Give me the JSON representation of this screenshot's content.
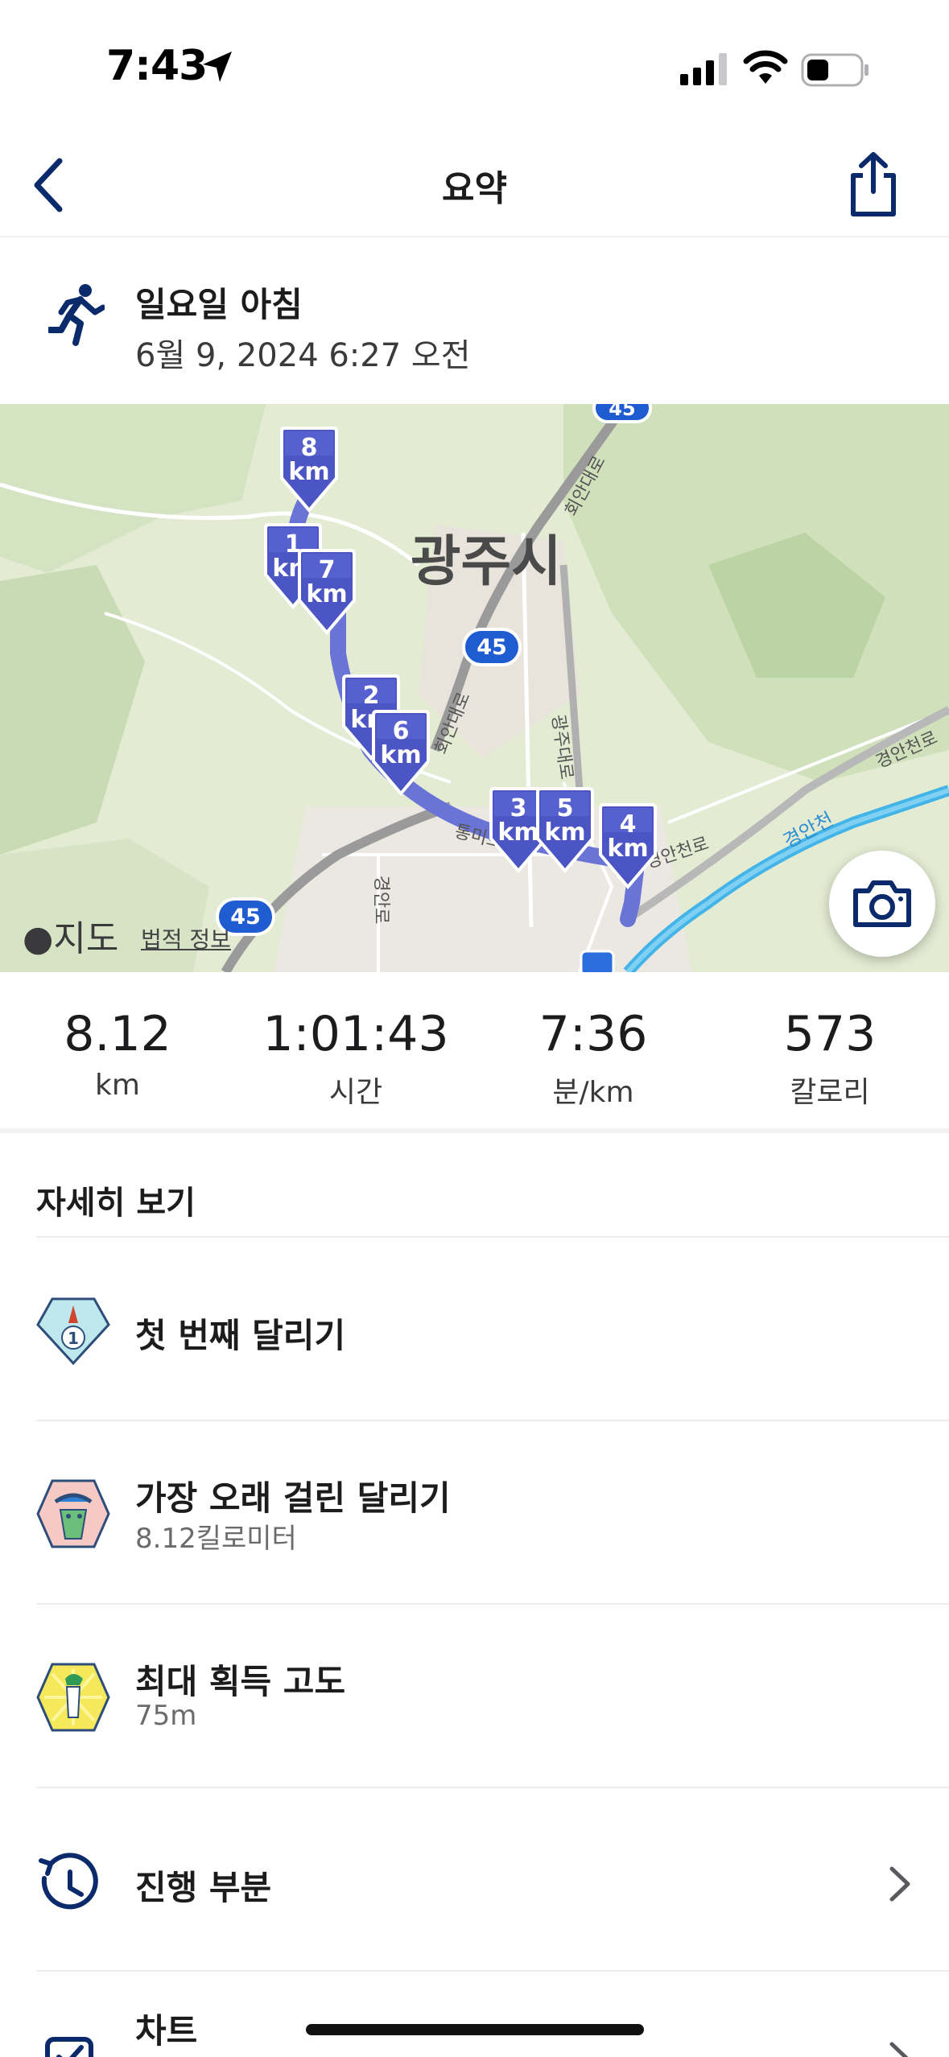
{
  "status_bar": {
    "time": "7:43"
  },
  "nav": {
    "title": "요약",
    "back_icon": "chevron-left-icon",
    "share_icon": "share-icon"
  },
  "activity": {
    "name": "일요일 아침",
    "datetime": "6월 9, 2024 6:27 오전",
    "icon": "runner-icon"
  },
  "map": {
    "city_label": "광주시",
    "attribution": "지도",
    "legal": "법적 정보",
    "route_shields": [
      "45",
      "45",
      "45",
      "45"
    ],
    "road_labels": [
      "회안대로",
      "회안대로",
      "광주대로",
      "통미로",
      "경안천로",
      "경안천로",
      "경안천",
      "경안로"
    ],
    "km_markers": [
      {
        "num": "8",
        "unit": "km"
      },
      {
        "num": "1",
        "unit": "km"
      },
      {
        "num": "7",
        "unit": "km"
      },
      {
        "num": "2",
        "unit": "km"
      },
      {
        "num": "6",
        "unit": "km"
      },
      {
        "num": "3",
        "unit": "km"
      },
      {
        "num": "5",
        "unit": "km"
      },
      {
        "num": "4",
        "unit": "km"
      }
    ]
  },
  "stats": [
    {
      "value": "8.12",
      "unit": "km"
    },
    {
      "value": "1:01:43",
      "unit": "시간"
    },
    {
      "value": "7:36",
      "unit": "분/km"
    },
    {
      "value": "573",
      "unit": "칼로리"
    }
  ],
  "details": {
    "title": "자세히 보기",
    "items": [
      {
        "title": "첫 번째 달리기",
        "subtitle": "",
        "icon": "first-run-badge-icon"
      },
      {
        "title": "가장 오래 걸린 달리기",
        "subtitle": "8.12킬로미터",
        "icon": "longest-run-badge-icon"
      },
      {
        "title": "최대 획득 고도",
        "subtitle": "75m",
        "icon": "elevation-badge-icon"
      },
      {
        "title": "진행 부분",
        "subtitle": "",
        "icon": "clock-icon"
      },
      {
        "title": "차트",
        "subtitle": "",
        "icon": "chart-icon"
      }
    ]
  },
  "colors": {
    "route": "#6a74d6",
    "marker": "#4b55c4",
    "accent": "#0a2a6b"
  }
}
